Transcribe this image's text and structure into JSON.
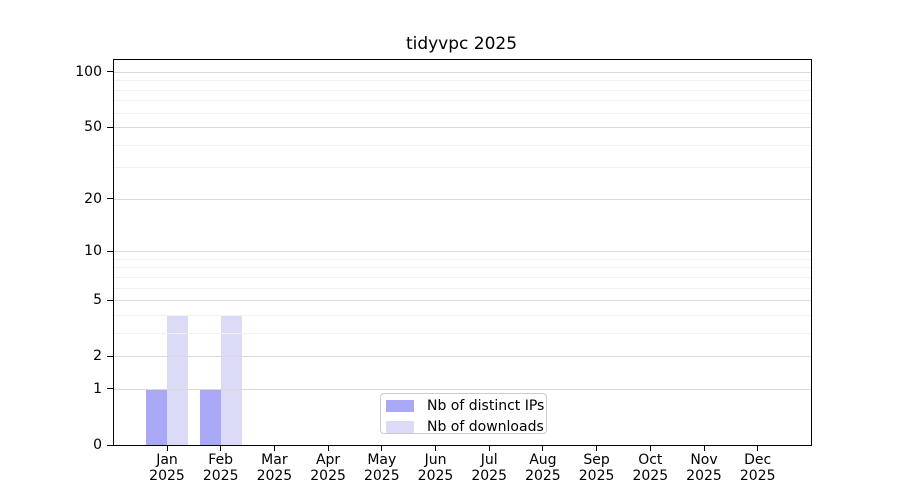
{
  "chart_data": {
    "type": "bar",
    "title": "tidyvpc 2025",
    "months": [
      "Jan",
      "Feb",
      "Mar",
      "Apr",
      "May",
      "Jun",
      "Jul",
      "Aug",
      "Sep",
      "Oct",
      "Nov",
      "Dec"
    ],
    "year": "2025",
    "categories": [
      "Jan 2025",
      "Feb 2025",
      "Mar 2025",
      "Apr 2025",
      "May 2025",
      "Jun 2025",
      "Jul 2025",
      "Aug 2025",
      "Sep 2025",
      "Oct 2025",
      "Nov 2025",
      "Dec 2025"
    ],
    "series": [
      {
        "name": "Nb of distinct IPs",
        "color": "#a8a8f4",
        "values": [
          1,
          1,
          0,
          0,
          0,
          0,
          0,
          0,
          0,
          0,
          0,
          0
        ]
      },
      {
        "name": "Nb of downloads",
        "color": "#dbdbf8",
        "values": [
          4,
          4,
          0,
          0,
          0,
          0,
          0,
          0,
          0,
          0,
          0,
          0
        ]
      }
    ],
    "xlabel": "",
    "ylabel": "",
    "yscale": "log10(1+v)",
    "ylim": [
      0,
      116
    ],
    "y_major_ticks": [
      0,
      1,
      2,
      5,
      10,
      20,
      50,
      100
    ],
    "y_minor_gridlines": [
      3,
      4,
      6,
      7,
      8,
      9,
      30,
      40,
      60,
      70,
      80,
      90
    ],
    "grid": true,
    "legend_position": "lower-center-inside",
    "colors": {
      "grid_major": "#d9d9d9",
      "grid_minor": "#f1f1f1",
      "spine": "#000000",
      "legend_border": "#cccccc",
      "background": "#ffffff"
    }
  }
}
